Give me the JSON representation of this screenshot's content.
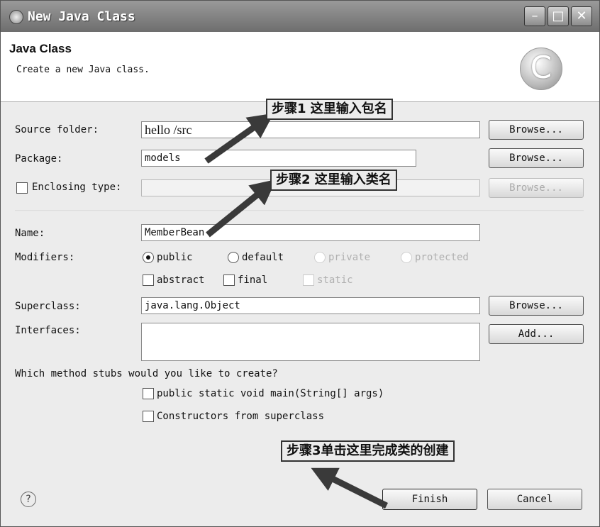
{
  "window": {
    "title": "New Java Class",
    "controls": {
      "minimize": "–",
      "maximize": "□",
      "close": "✕"
    }
  },
  "header": {
    "title": "Java Class",
    "description": "Create a new Java class.",
    "logo_letter": "C"
  },
  "form": {
    "source_folder": {
      "label": "Source folder:",
      "value": "hello /src",
      "button": "Browse..."
    },
    "package": {
      "label": "Package:",
      "value": "models",
      "button": "Browse..."
    },
    "enclosing_type": {
      "label": "Enclosing type:",
      "value": "",
      "button": "Browse...",
      "checked": false
    },
    "name": {
      "label": "Name:",
      "value": "MemberBean"
    },
    "modifiers": {
      "label": "Modifiers:",
      "access": [
        {
          "label": "public",
          "selected": true,
          "enabled": true
        },
        {
          "label": "default",
          "selected": false,
          "enabled": true
        },
        {
          "label": "private",
          "selected": false,
          "enabled": false
        },
        {
          "label": "protected",
          "selected": false,
          "enabled": false
        }
      ],
      "flags": [
        {
          "label": "abstract",
          "checked": false,
          "enabled": true
        },
        {
          "label": "final",
          "checked": false,
          "enabled": true
        },
        {
          "label": "static",
          "checked": false,
          "enabled": false
        }
      ]
    },
    "superclass": {
      "label": "Superclass:",
      "value": "java.lang.Object",
      "button": "Browse..."
    },
    "interfaces": {
      "label": "Interfaces:",
      "button": "Add..."
    },
    "stubs": {
      "question": "Which method stubs would you like to create?",
      "options": [
        {
          "label": "public static void main(String[] args)",
          "checked": false
        },
        {
          "label": "Constructors from superclass",
          "checked": false
        }
      ]
    }
  },
  "annotations": {
    "step1": "步骤1 这里输入包名",
    "step2": "步骤2 这里输入类名",
    "step3": "步骤3单击这里完成类的创建"
  },
  "footer": {
    "help": "?",
    "finish": "Finish",
    "cancel": "Cancel"
  },
  "colors": {
    "dialog_bg": "#ececec",
    "titlebar": "#7a7a7a",
    "arrow": "#3a3a3a"
  }
}
